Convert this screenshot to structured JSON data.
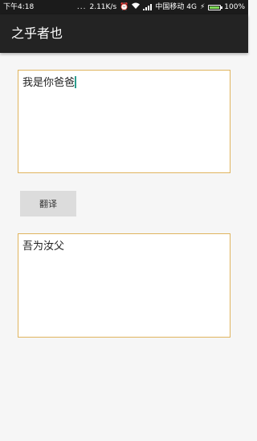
{
  "status_bar": {
    "time": "下午4:18",
    "dots": "...",
    "speed": "2.11K/s",
    "carrier": "中国移动 4G",
    "battery": "100%",
    "battery_level": 1.0
  },
  "app_bar": {
    "title": "之乎者也"
  },
  "input": {
    "value": "我是你爸爸"
  },
  "translate_button": {
    "label": "翻译"
  },
  "output": {
    "value": "吾为汝父"
  },
  "colors": {
    "status_bar_bg": "#1b1b1b",
    "app_bar_bg": "#232323",
    "textbox_border": "#e0b45e",
    "button_bg": "#dcdcdc",
    "cursor": "#2c9c8d"
  }
}
